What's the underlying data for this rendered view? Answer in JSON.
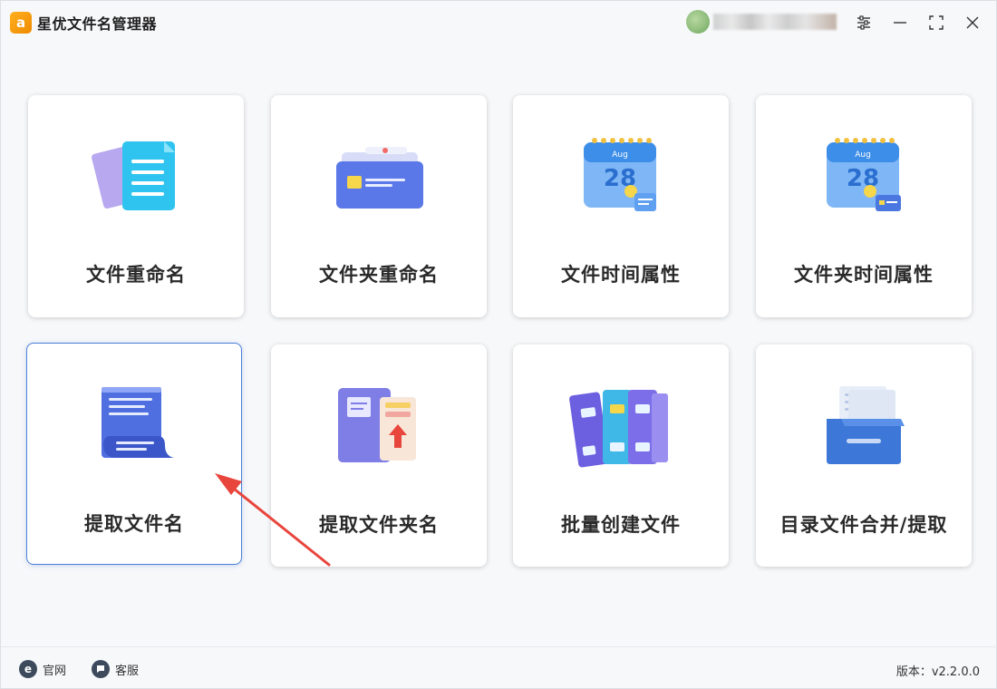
{
  "app": {
    "logo_text": "a",
    "title": "星优文件名管理器"
  },
  "cards": [
    {
      "label": "文件重命名",
      "icon": "files-icon"
    },
    {
      "label": "文件夹重命名",
      "icon": "folder-icon"
    },
    {
      "label": "文件时间属性",
      "icon": "calendar-icon"
    },
    {
      "label": "文件夹时间属性",
      "icon": "calendar-folder-icon"
    },
    {
      "label": "提取文件名",
      "icon": "scroll-document-icon"
    },
    {
      "label": "提取文件夹名",
      "icon": "book-folder-icon"
    },
    {
      "label": "批量创建文件",
      "icon": "binders-icon"
    },
    {
      "label": "目录文件合并/提取",
      "icon": "file-tray-icon"
    }
  ],
  "calendar": {
    "month": "Aug",
    "day": "28"
  },
  "footer": {
    "website_label": "官网",
    "service_label": "客服",
    "version_label": "版本：v2.2.0.0"
  },
  "colors": {
    "accent": "#4a7fd8",
    "annotation_arrow": "#e8453c"
  }
}
